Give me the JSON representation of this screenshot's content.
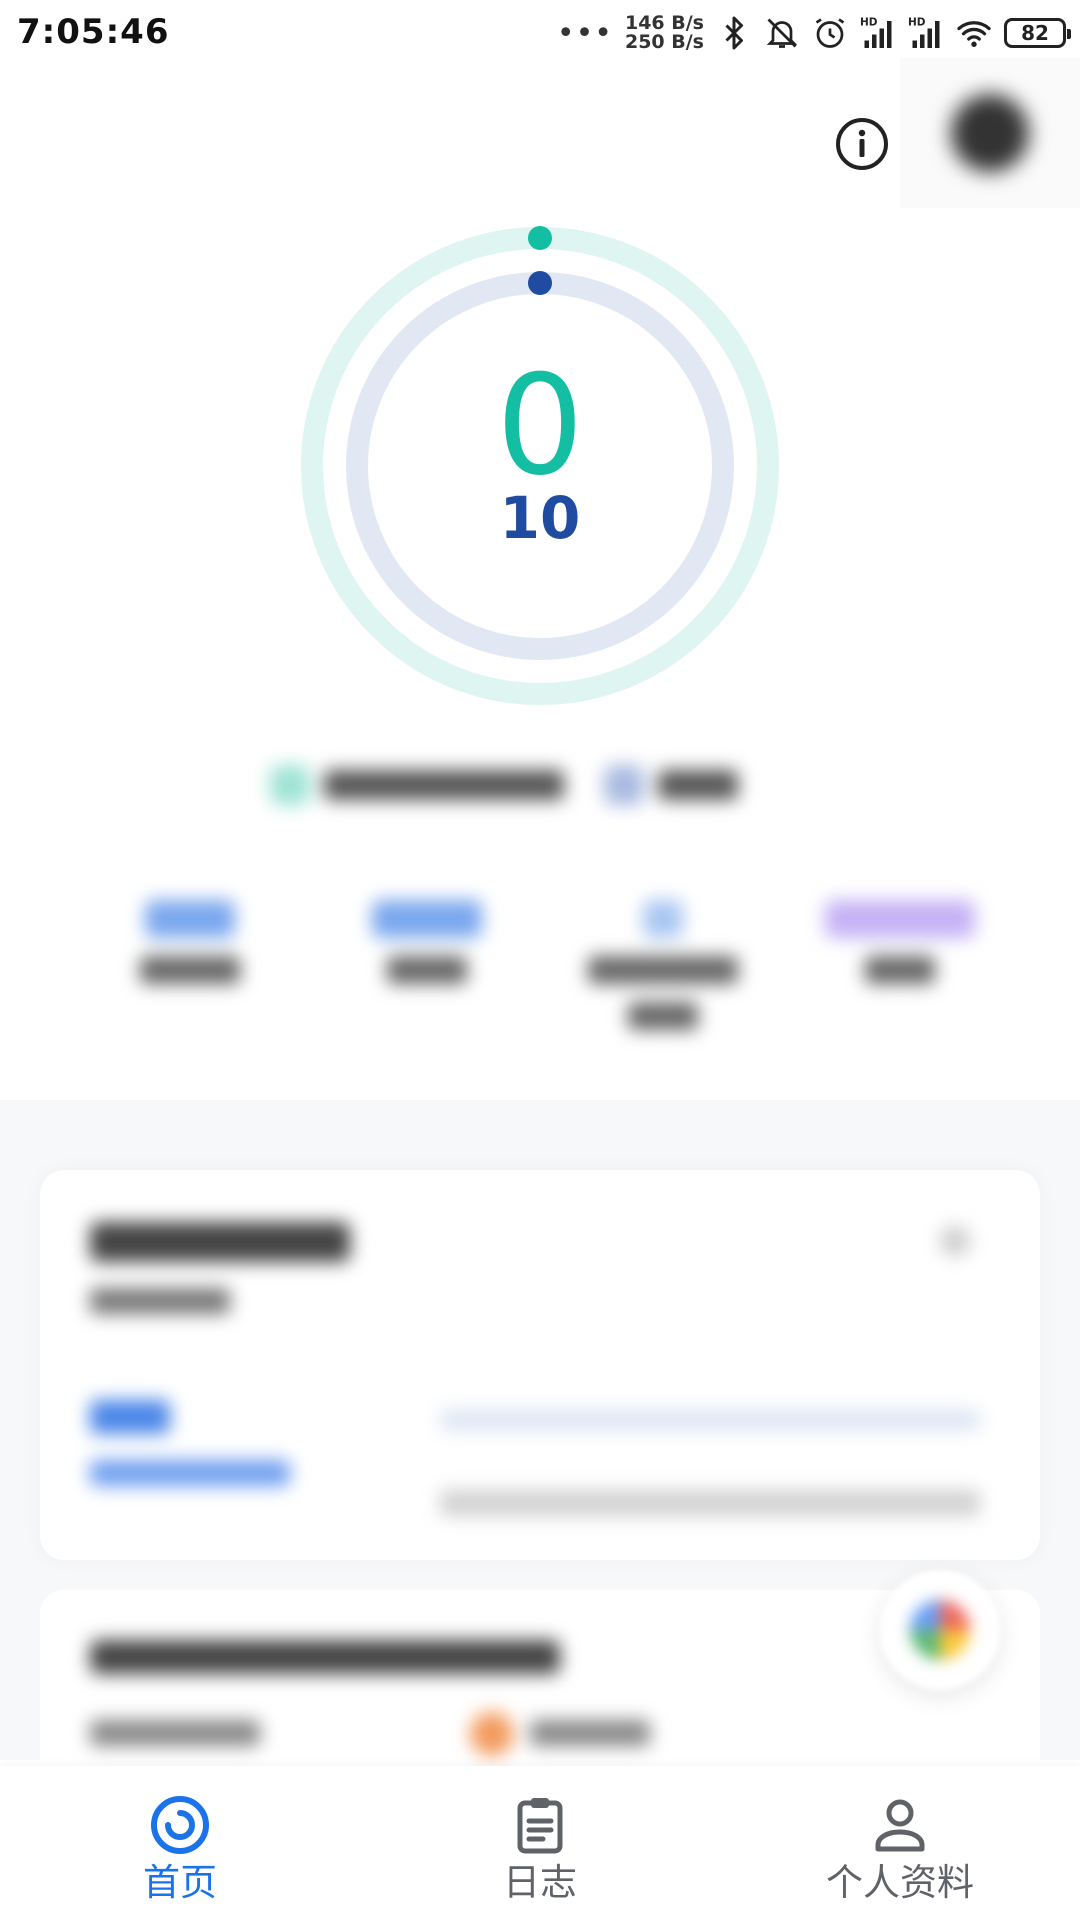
{
  "status_bar": {
    "time": "7:05:46",
    "dots": "•••",
    "upload_speed": "146 B/s",
    "download_speed": "250 B/s",
    "battery": "82",
    "icons": [
      "bluetooth-icon",
      "muted-bell-icon",
      "alarm-icon",
      "signal-hd-icon",
      "signal-hd-icon",
      "wifi-icon",
      "battery-icon"
    ]
  },
  "header": {
    "info_icon": "info-icon",
    "avatar": "avatar"
  },
  "rings": {
    "outer_value": "0",
    "inner_value": "10",
    "outer_progress": 0,
    "inner_progress": 0,
    "outer_color": "#13bea3",
    "inner_color": "#1f4ba0",
    "outer_track_color": "#dff5f1",
    "inner_track_color": "#e2e8f3"
  },
  "bottom_nav": {
    "items": [
      {
        "label": "首页",
        "icon": "home-ring-icon",
        "active": true
      },
      {
        "label": "日志",
        "icon": "clipboard-icon",
        "active": false
      },
      {
        "label": "个人资料",
        "icon": "person-icon",
        "active": false
      }
    ],
    "active_color": "#1a73e8",
    "inactive_color": "#5f6368"
  }
}
